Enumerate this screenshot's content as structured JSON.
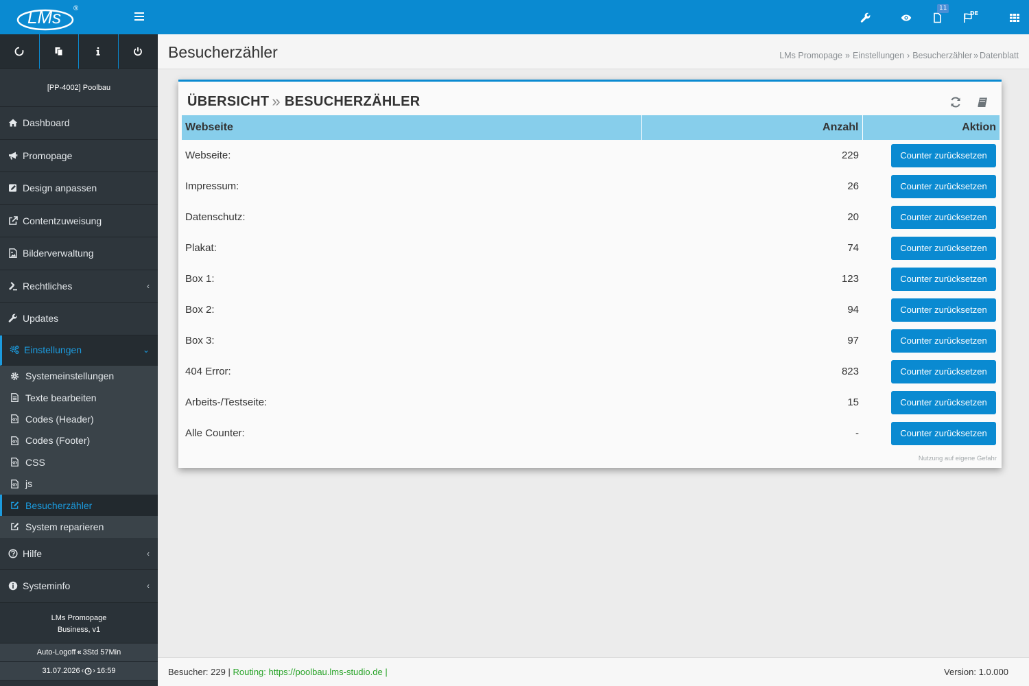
{
  "topbar": {
    "logo_text": "LMs",
    "registered": "®",
    "notifications_count": "11",
    "language": "DE"
  },
  "sidebar": {
    "project": "[PP-4002] Poolbau",
    "nav": [
      {
        "label": "Dashboard",
        "icon": "home-icon"
      },
      {
        "label": "Promopage",
        "icon": "bullhorn-icon"
      },
      {
        "label": "Design anpassen",
        "icon": "edit-icon"
      },
      {
        "label": "Contentzuweisung",
        "icon": "external-link-icon"
      },
      {
        "label": "Bilderverwaltung",
        "icon": "image-file-icon"
      },
      {
        "label": "Rechtliches",
        "icon": "gavel-icon"
      },
      {
        "label": "Updates",
        "icon": "wrench-icon"
      },
      {
        "label": "Einstellungen",
        "icon": "gears-icon"
      }
    ],
    "subnav": [
      {
        "label": "Systemeinstellungen",
        "icon": "gear-icon"
      },
      {
        "label": "Texte bearbeiten",
        "icon": "file-text-icon"
      },
      {
        "label": "Codes (Header)",
        "icon": "file-code-icon"
      },
      {
        "label": "Codes (Footer)",
        "icon": "file-code-icon"
      },
      {
        "label": "CSS",
        "icon": "file-code-icon"
      },
      {
        "label": "js",
        "icon": "file-code-icon"
      },
      {
        "label": "Besucherzähler",
        "icon": "edit-icon"
      },
      {
        "label": "System reparieren",
        "icon": "edit-icon"
      }
    ],
    "nav_bottom": [
      {
        "label": "Hilfe",
        "icon": "question-circle-icon"
      },
      {
        "label": "Systeminfo",
        "icon": "info-circle-icon"
      }
    ],
    "footer": {
      "product": "LMs Promopage",
      "edition": "Business, v1",
      "autologoff_label": "Auto-Logoff",
      "autologoff_value": "3Std 57Min",
      "date": "31.07.2026",
      "time": "16:59"
    }
  },
  "header": {
    "title": "Besucherzähler",
    "breadcrumb": [
      "LMs Promopage",
      "Einstellungen",
      "Besucherzähler",
      "Datenblatt"
    ]
  },
  "panel": {
    "title_part1": "ÜBERSICHT",
    "title_part2": "BESUCHERZÄHLER",
    "columns": [
      "Webseite",
      "Anzahl",
      "Aktion"
    ],
    "rows": [
      {
        "page": "Webseite:",
        "count": "229",
        "action": "Counter zurücksetzen"
      },
      {
        "page": "Impressum:",
        "count": "26",
        "action": "Counter zurücksetzen"
      },
      {
        "page": "Datenschutz:",
        "count": "20",
        "action": "Counter zurücksetzen"
      },
      {
        "page": "Plakat:",
        "count": "74",
        "action": "Counter zurücksetzen"
      },
      {
        "page": "Box 1:",
        "count": "123",
        "action": "Counter zurücksetzen"
      },
      {
        "page": "Box 2:",
        "count": "94",
        "action": "Counter zurücksetzen"
      },
      {
        "page": "Box 3:",
        "count": "97",
        "action": "Counter zurücksetzen"
      },
      {
        "page": "404 Error:",
        "count": "823",
        "action": "Counter zurücksetzen"
      },
      {
        "page": "Arbeits-/Testseite:",
        "count": "15",
        "action": "Counter zurücksetzen"
      },
      {
        "page": "Alle Counter:",
        "count": "-",
        "action": "Counter zurücksetzen"
      }
    ],
    "note": "Nutzung auf eigene Gefahr"
  },
  "footer": {
    "visitors": "Besucher: 229",
    "routing": "Routing: https://poolbau.lms-studio.de",
    "version": "Version: 1.0.000"
  },
  "colors": {
    "primary": "#0a8ad1",
    "table_header": "#87ceeb",
    "sidebar": "#2e363c",
    "routing_green": "#27a327"
  }
}
